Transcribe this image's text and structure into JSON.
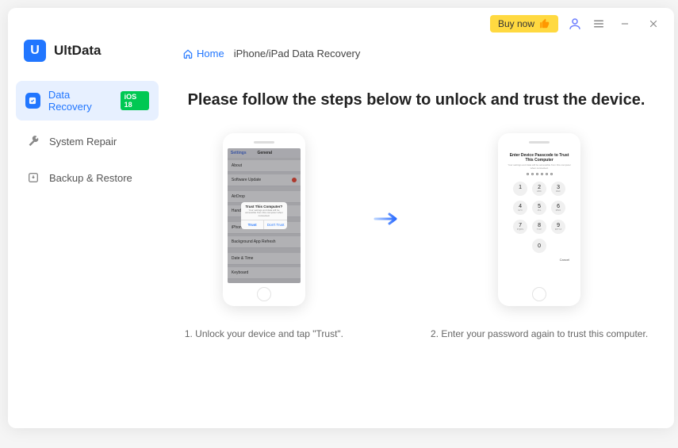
{
  "titlebar": {
    "buy_now": "Buy now"
  },
  "brand": {
    "name": "UltData",
    "logo_letter": "U"
  },
  "sidebar": {
    "items": [
      {
        "label": "Data Recovery",
        "badge": "iOS 18"
      },
      {
        "label": "System Repair"
      },
      {
        "label": "Backup & Restore"
      }
    ]
  },
  "breadcrumb": {
    "home": "Home",
    "current": "iPhone/iPad Data Recovery"
  },
  "main": {
    "title": "Please follow the steps below to unlock and trust the device."
  },
  "step1": {
    "caption": "1. Unlock your device and tap \"Trust\".",
    "settings_back": "Settings",
    "settings_title": "General",
    "rows": {
      "about": "About",
      "software_update": "Software Update",
      "airdrop": "AirDrop",
      "handoff": "Handoff",
      "iphone_storage": "iPhone Storage",
      "background_refresh": "Background App Refresh",
      "date_time": "Date & Time",
      "keyboard": "Keyboard"
    },
    "dialog": {
      "title": "Trust This Computer?",
      "body": "Your settings and data will be accessible from this computer when connected.",
      "trust": "Trust",
      "dont_trust": "Don't Trust"
    }
  },
  "step2": {
    "caption": "2. Enter your password again to trust this computer.",
    "title": "Enter Device Passcode to Trust This Computer",
    "sub": "Your settings and data will be accessible from this computer when connected.",
    "cancel": "Cancel",
    "keys": {
      "k1": "1",
      "k2": "2",
      "k2s": "ABC",
      "k3": "3",
      "k3s": "DEF",
      "k4": "4",
      "k4s": "GHI",
      "k5": "5",
      "k5s": "JKL",
      "k6": "6",
      "k6s": "MNO",
      "k7": "7",
      "k7s": "PQRS",
      "k8": "8",
      "k8s": "TUV",
      "k9": "9",
      "k9s": "WXYZ",
      "k0": "0"
    }
  }
}
